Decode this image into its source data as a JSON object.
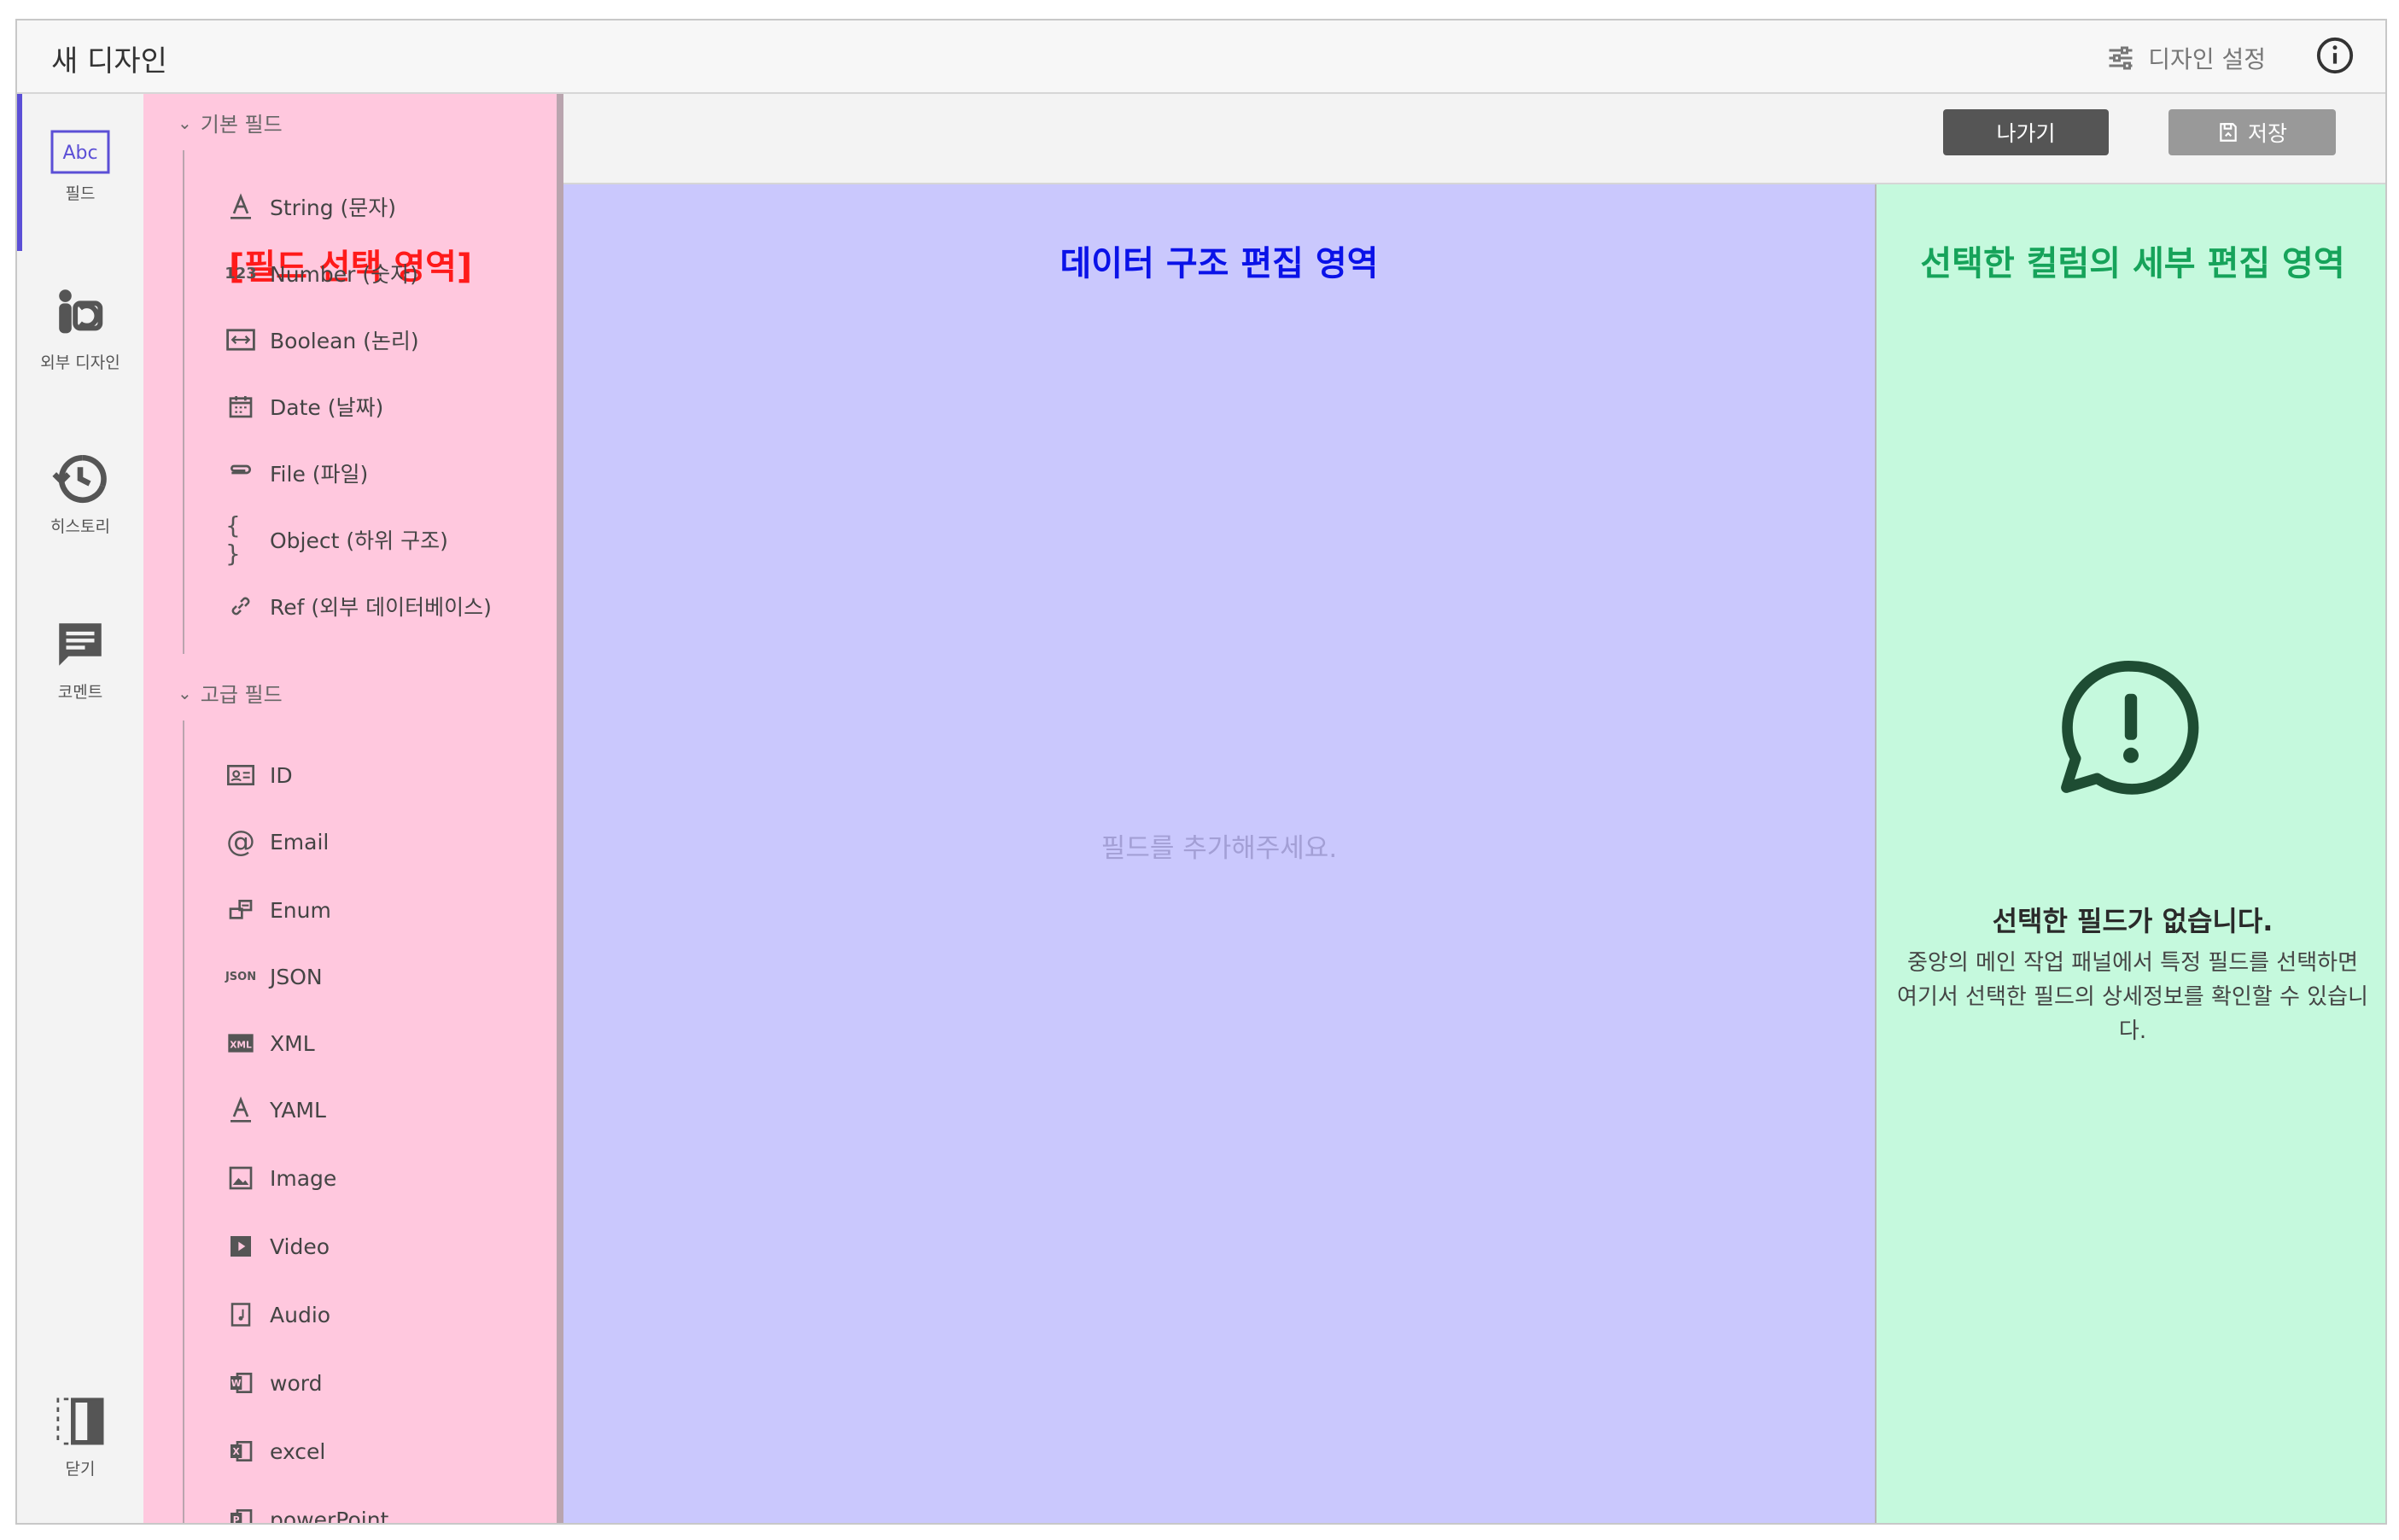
{
  "app": {
    "title": "새 디자인"
  },
  "topbar": {
    "design_settings_label": "디자인 설정",
    "info_icon": "info-circle-icon"
  },
  "leftnav": {
    "items": [
      {
        "label": "필드",
        "icon": "abc-field-icon",
        "active": true
      },
      {
        "label": "외부 디자인",
        "icon": "external-design-icon"
      },
      {
        "label": "히스토리",
        "icon": "history-icon"
      },
      {
        "label": "코멘트",
        "icon": "comment-icon"
      },
      {
        "label": "닫기",
        "icon": "close-panel-icon"
      }
    ]
  },
  "field_panel": {
    "zone_label": "[필드 선택 영역]",
    "basic": {
      "title": "기본 필드",
      "items": [
        {
          "label": "String (문자)",
          "icon": "text-a-icon"
        },
        {
          "label": "Number (숫자)",
          "icon": "number-123-icon"
        },
        {
          "label": "Boolean (논리)",
          "icon": "boolean-icon"
        },
        {
          "label": "Date (날짜)",
          "icon": "calendar-icon"
        },
        {
          "label": "File (파일)",
          "icon": "paperclip-icon"
        },
        {
          "label": "Object (하위 구조)",
          "icon": "braces-icon"
        },
        {
          "label": "Ref (외부 데이터베이스)",
          "icon": "link-icon"
        }
      ]
    },
    "advanced": {
      "title": "고급 필드",
      "items": [
        {
          "label": "ID",
          "icon": "id-card-icon"
        },
        {
          "label": "Email",
          "icon": "at-sign-icon"
        },
        {
          "label": "Enum",
          "icon": "enum-icon"
        },
        {
          "label": "JSON",
          "icon": "json-icon"
        },
        {
          "label": "XML",
          "icon": "xml-icon"
        },
        {
          "label": "YAML",
          "icon": "yaml-icon"
        },
        {
          "label": "Image",
          "icon": "image-icon"
        },
        {
          "label": "Video",
          "icon": "video-icon"
        },
        {
          "label": "Audio",
          "icon": "audio-icon"
        },
        {
          "label": "word",
          "icon": "word-icon"
        },
        {
          "label": "excel",
          "icon": "excel-icon"
        },
        {
          "label": "powerPoint",
          "icon": "powerpoint-icon"
        }
      ]
    }
  },
  "toolbar": {
    "exit_label": "나가기",
    "save_label": "저장"
  },
  "main": {
    "zone_label": "데이터 구조 편집 영역",
    "placeholder": "필드를 추가해주세요."
  },
  "detail": {
    "zone_label": "선택한 컬럼의 세부 편집 영역",
    "empty_title": "선택한 필드가 없습니다.",
    "empty_desc": "중앙의 메인 작업 패널에서 특정 필드를 선택하면 여기서 선택한 필드의 상세정보를 확인할 수 있습니다."
  },
  "colors": {
    "accent": "#5b4fd6",
    "field_zone": "#ffc8de",
    "main_zone": "#cac8fd",
    "detail_zone": "#c5f9dd"
  }
}
